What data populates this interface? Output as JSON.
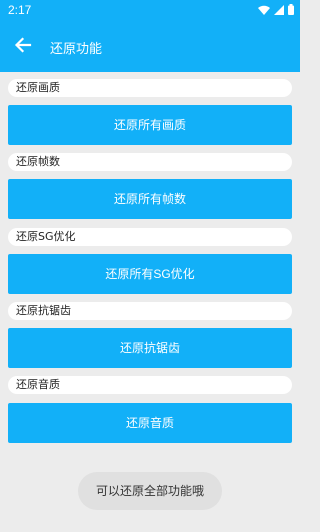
{
  "status": {
    "time": "2:17"
  },
  "header": {
    "title": "还原功能"
  },
  "sections": [
    {
      "label": "还原画质",
      "button": "还原所有画质"
    },
    {
      "label": "还原帧数",
      "button": "还原所有帧数"
    },
    {
      "label": "还原SG优化",
      "button": "还原所有SG优化"
    },
    {
      "label": "还原抗锯齿",
      "button": "还原抗锯齿"
    },
    {
      "label": "还原音质",
      "button": "还原音质"
    }
  ],
  "toast": "可以还原全部功能哦",
  "colors": {
    "accent": "#12b0f8",
    "background": "#ececec"
  },
  "icons": {
    "back": "arrow-left-icon",
    "wifi": "wifi-icon",
    "signal": "signal-icon",
    "battery": "battery-icon"
  }
}
